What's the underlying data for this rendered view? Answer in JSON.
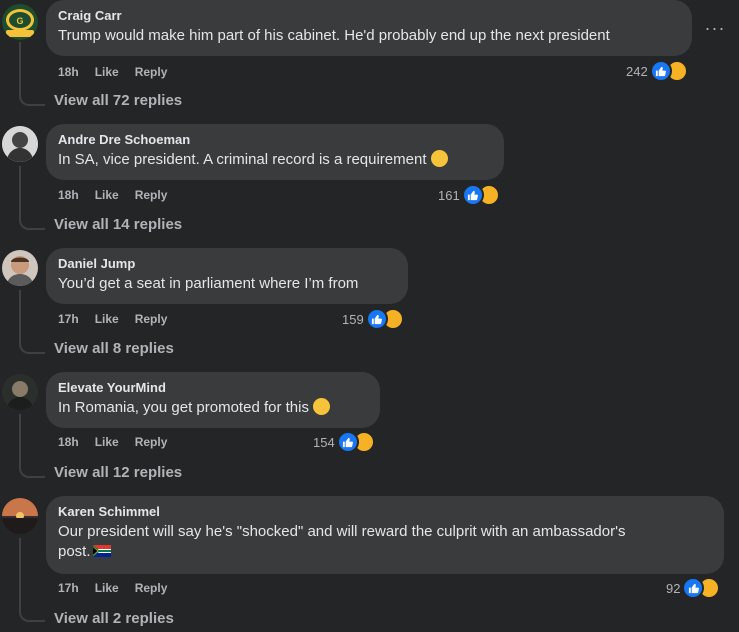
{
  "more_options_label": "···",
  "comments": [
    {
      "author": "Craig Carr",
      "text": "Trump would make him part of his cabinet. He'd probably end up the next president",
      "time": "18h",
      "like_label": "Like",
      "reply_label": "Reply",
      "reaction_count": "242",
      "view_replies": "View all 72 replies",
      "avatar": "packers-logo-avatar"
    },
    {
      "author": "Andre Dre Schoeman",
      "text": "In SA, vice president. A criminal record is a requirement",
      "emoji": "thinking-face",
      "time": "18h",
      "like_label": "Like",
      "reply_label": "Reply",
      "reaction_count": "161",
      "view_replies": "View all 14 replies",
      "avatar": "bw-portrait-avatar"
    },
    {
      "author": "Daniel Jump",
      "text": "You’d get a seat in parliament where I’m from",
      "time": "17h",
      "like_label": "Like",
      "reply_label": "Reply",
      "reaction_count": "159",
      "view_replies": "View all 8 replies",
      "avatar": "man-portrait-avatar"
    },
    {
      "author": "Elevate YourMind",
      "text": "In Romania, you get promoted for this",
      "emoji": "face-with-raised-eyebrow",
      "time": "18h",
      "like_label": "Like",
      "reply_label": "Reply",
      "reaction_count": "154",
      "view_replies": "View all 12 replies",
      "avatar": "dark-portrait-avatar"
    },
    {
      "author": "Karen Schimmel",
      "text_line1": "Our president will say he's \"shocked\" and will reward the culprit with an ambassador's",
      "text_line2": "post.",
      "emoji": "south-africa-flag",
      "time": "17h",
      "like_label": "Like",
      "reply_label": "Reply",
      "reaction_count": "92",
      "view_replies": "View all 2 replies",
      "avatar": "sunset-landscape-avatar"
    }
  ],
  "colors": {
    "background": "#242526",
    "bubble": "#3a3b3c",
    "like_blue": "#1877f2",
    "haha_yellow": "#f7b125",
    "secondary_text": "#b0b3b8"
  }
}
